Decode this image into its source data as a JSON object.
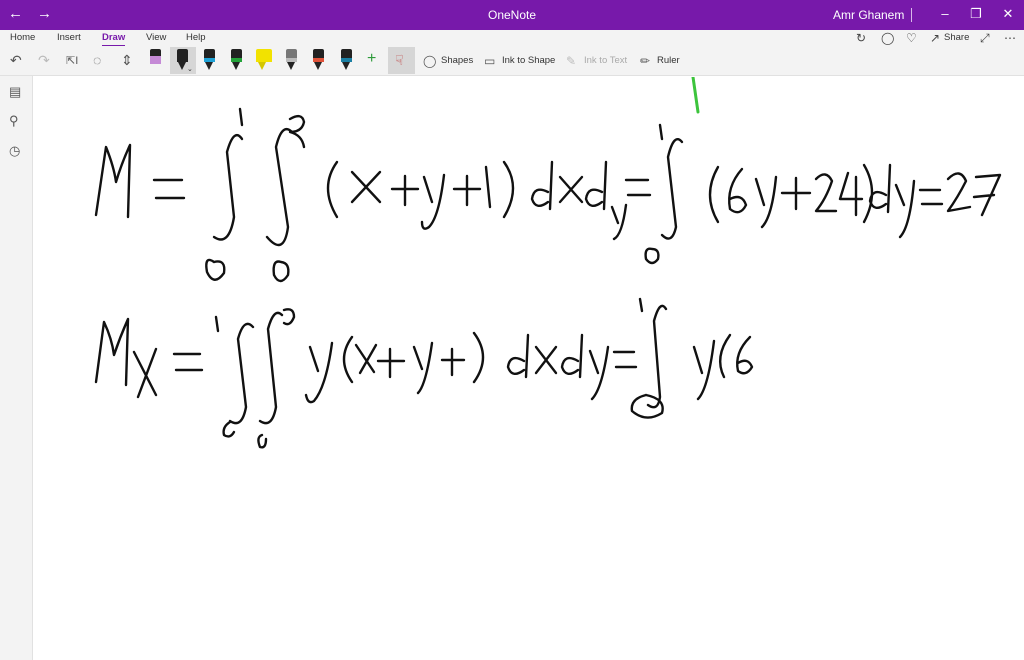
{
  "window": {
    "title": "OneNote",
    "user": "Amr Ghanem",
    "back_icon": "arrow-left-icon",
    "forward_icon": "arrow-right-icon"
  },
  "ribbon": {
    "tabs": [
      "Home",
      "Insert",
      "Draw",
      "View",
      "Help"
    ],
    "active_tab": "Draw",
    "share_label": "Share",
    "accent_color": "#7719aa"
  },
  "toolbar": {
    "shapes_label": "Shapes",
    "ink_to_shape_label": "Ink to Shape",
    "ink_to_text_label": "Ink to Text",
    "ruler_label": "Ruler",
    "pens": [
      {
        "name": "pink-highlighter",
        "color": "#c58ad6"
      },
      {
        "name": "black-pen",
        "color": "#222222"
      },
      {
        "name": "blue-pen",
        "color": "#1fa2d6"
      },
      {
        "name": "green-pen",
        "color": "#24a33a"
      },
      {
        "name": "yellow-highlighter",
        "color": "#f2e200"
      },
      {
        "name": "galaxy-pen",
        "color": "#9c9c9c"
      },
      {
        "name": "red-pen",
        "color": "#e0533a"
      },
      {
        "name": "teal-pen",
        "color": "#1a7fa3"
      }
    ]
  },
  "ink_color": "#111111",
  "green_mark_color": "#3cc43c"
}
